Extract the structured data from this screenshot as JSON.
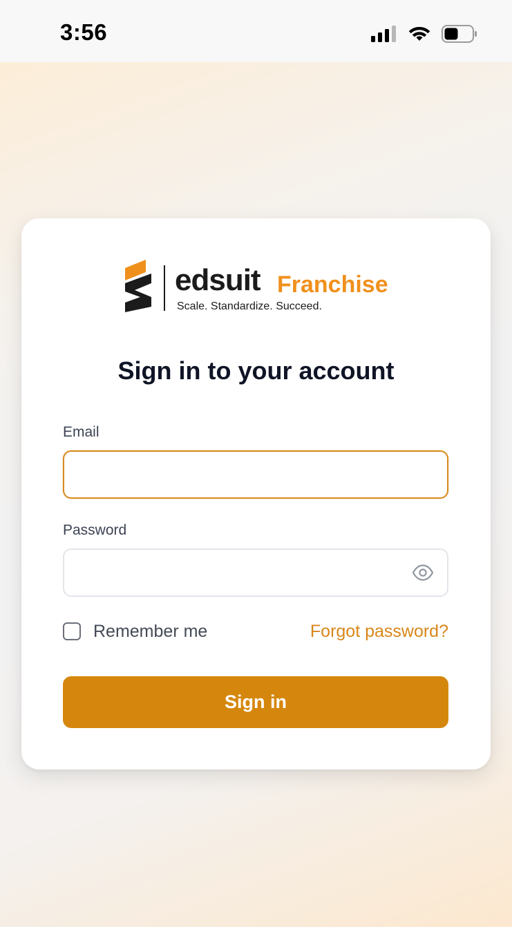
{
  "status_bar": {
    "time": "3:56",
    "icons": [
      "cellular-signal-icon",
      "wifi-icon",
      "battery-icon"
    ]
  },
  "logo": {
    "brand": "edsuit",
    "product": "Franchise",
    "tagline": "Scale. Standardize. Succeed.",
    "colors": {
      "brand_dark": "#1b1b1b",
      "brand_orange": "#f0901c"
    }
  },
  "form": {
    "title": "Sign in to your account",
    "email": {
      "label": "Email",
      "value": "",
      "placeholder": ""
    },
    "password": {
      "label": "Password",
      "value": "",
      "placeholder": "",
      "toggle_icon": "eye-icon"
    },
    "remember": {
      "label": "Remember me",
      "checked": false
    },
    "forgot_link": "Forgot password?",
    "submit_label": "Sign in"
  },
  "colors": {
    "accent": "#d5870d",
    "link": "#d8861a",
    "heading": "#0f1426"
  }
}
